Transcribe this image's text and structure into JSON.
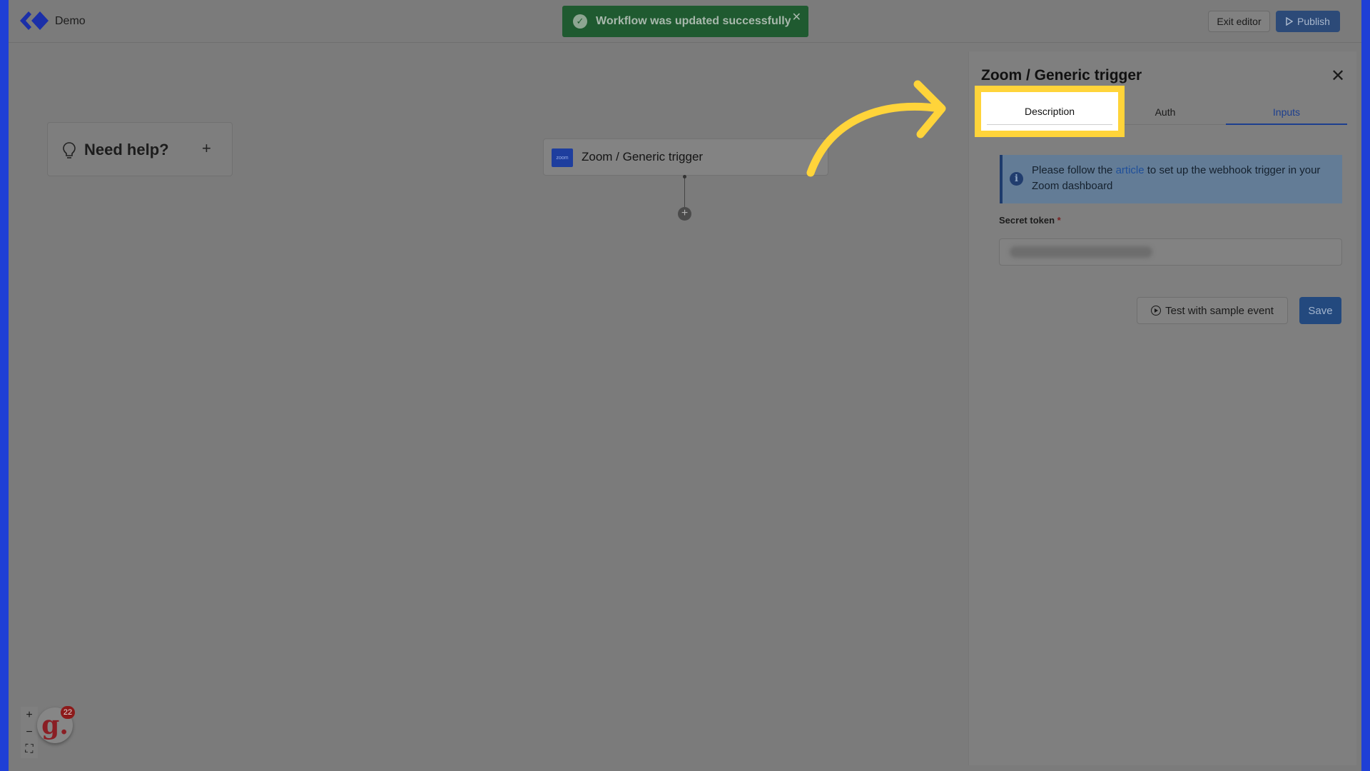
{
  "header": {
    "brand": "Demo",
    "exit_label": "Exit editor",
    "publish_label": "Publish"
  },
  "toast": {
    "message": "Workflow was updated successfully"
  },
  "help": {
    "label": "Need help?"
  },
  "node": {
    "title": "Zoom / Generic trigger",
    "icon_text": "zoom"
  },
  "panel": {
    "title": "Zoom / Generic trigger",
    "tabs": [
      {
        "label": "Description"
      },
      {
        "label": "Auth"
      },
      {
        "label": "Inputs"
      }
    ],
    "active_tab": "Inputs",
    "info": {
      "before": "Please follow the ",
      "link": "article",
      "after": " to set up the webhook trigger in your Zoom dashboard"
    },
    "secret_label": "Secret token",
    "required_mark": "*",
    "test_label": "Test with sample event",
    "save_label": "Save"
  },
  "assistant": {
    "badge_count": "22",
    "letter": "g."
  },
  "colors": {
    "accent": "#1d3f8f",
    "highlight": "#ffd43a",
    "toast": "#1f5a30",
    "frame": "#1f3fd6"
  }
}
